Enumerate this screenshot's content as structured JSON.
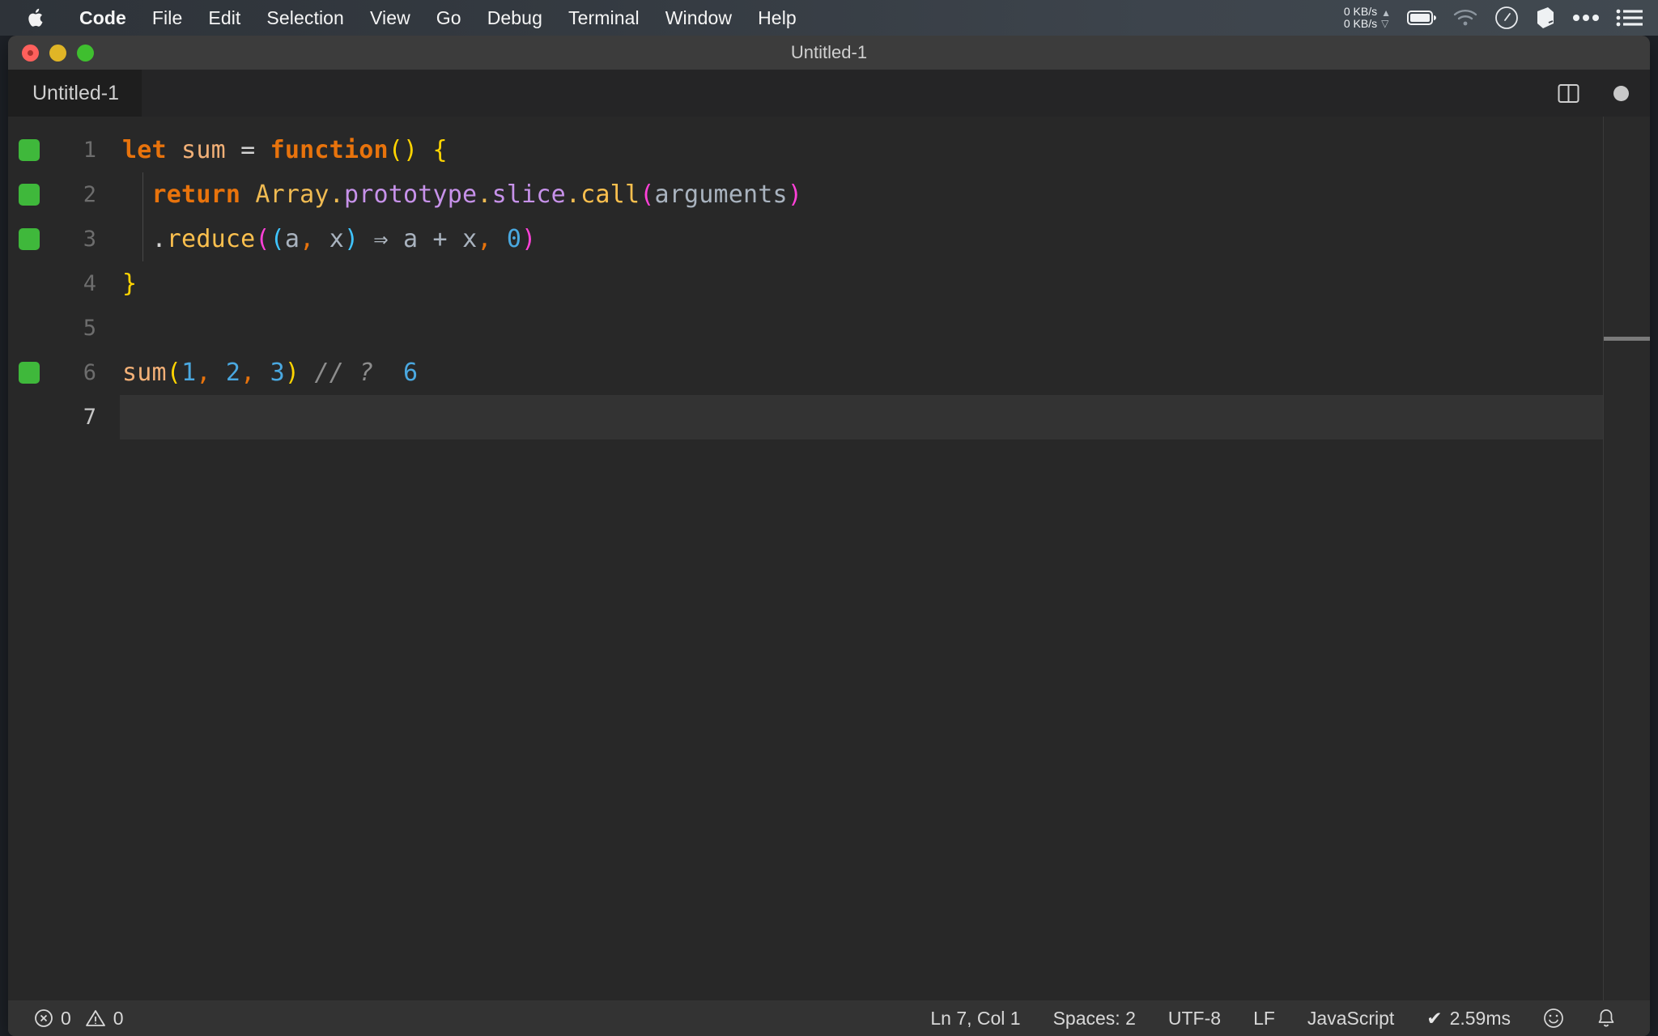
{
  "menubar": {
    "apple_icon": "apple-logo-icon",
    "items": [
      {
        "label": "Code",
        "bold": true
      },
      {
        "label": "File",
        "bold": false
      },
      {
        "label": "Edit",
        "bold": false
      },
      {
        "label": "Selection",
        "bold": false
      },
      {
        "label": "View",
        "bold": false
      },
      {
        "label": "Go",
        "bold": false
      },
      {
        "label": "Debug",
        "bold": false
      },
      {
        "label": "Terminal",
        "bold": false
      },
      {
        "label": "Window",
        "bold": false
      },
      {
        "label": "Help",
        "bold": false
      }
    ],
    "status": {
      "net_up": "0 KB/s",
      "net_down": "0 KB/s",
      "up_arrow": "▲",
      "down_arrow": "▽",
      "icons": [
        "battery-icon",
        "wifi-icon",
        "gauge-icon",
        "cube-icon",
        "ellipsis-icon",
        "list-icon"
      ]
    }
  },
  "window": {
    "title": "Untitled-1",
    "traffic_lights": [
      "close-button",
      "minimize-button",
      "maximize-button"
    ]
  },
  "tabbar": {
    "tabs": [
      {
        "label": "Untitled-1",
        "active": true
      }
    ],
    "actions": [
      "split-editor-icon",
      "unsaved-indicator-dot"
    ]
  },
  "editor": {
    "language": "javascript",
    "active_line": 7,
    "lines": [
      {
        "num": "1",
        "marked": true,
        "indent_guide": false,
        "active": false
      },
      {
        "num": "2",
        "marked": true,
        "indent_guide": true,
        "active": false
      },
      {
        "num": "3",
        "marked": true,
        "indent_guide": true,
        "active": false
      },
      {
        "num": "4",
        "marked": false,
        "indent_guide": false,
        "active": false
      },
      {
        "num": "5",
        "marked": false,
        "indent_guide": false,
        "active": false
      },
      {
        "num": "6",
        "marked": true,
        "indent_guide": false,
        "active": false
      },
      {
        "num": "7",
        "marked": false,
        "indent_guide": false,
        "active": true
      }
    ],
    "code": {
      "l1": {
        "t1": "let",
        "t2": " sum ",
        "t3": "= ",
        "t4": "function",
        "t5": "()",
        "t6": " {"
      },
      "l2": {
        "t1": "  ",
        "t2": "return",
        "t3": " Array",
        "t4": ".",
        "t5": "prototype",
        "t6": ".",
        "t7": "slice",
        "t8": ".",
        "t9": "call",
        "t10": "(",
        "t11": "arguments",
        "t12": ")"
      },
      "l3": {
        "t1": "  .",
        "t2": "reduce",
        "t3": "(",
        "t4": "(",
        "t5": "a",
        "t6": ",",
        "t7": " x",
        "t8": ")",
        "t9": " ⇒ ",
        "t10": "a + x",
        "t11": ",",
        "t12": " 0",
        "t13": ")"
      },
      "l4": {
        "t1": "}"
      },
      "l5": {
        "t1": ""
      },
      "l6": {
        "t1": "sum",
        "t2": "(",
        "t3": "1",
        "t4": ",",
        "t5": " 2",
        "t6": ",",
        "t7": " 3",
        "t8": ")",
        "t9": " // ?  ",
        "t10": "6"
      },
      "l7": {
        "t1": ""
      }
    },
    "colors": {
      "background": "#282828",
      "active_line": "#333333",
      "gutter_marker": "#3fb83b",
      "keyword": "#e8730c",
      "function_name": "#f2b077",
      "paren_yellow": "#ffd400",
      "paren_magenta": "#ff41d8",
      "paren_cyan": "#3fc4ff",
      "class_name": "#f0bb52",
      "property": "#c792ea",
      "method": "#fcc04e",
      "parameter": "#a9b3bf",
      "comma": "#e8730c",
      "number": "#4aa8e0",
      "comment": "#8d8d8d"
    }
  },
  "statusbar": {
    "errors_icon": "error-circle-icon",
    "errors_count": "0",
    "warnings_icon": "warning-triangle-icon",
    "warnings_count": "0",
    "cursor_position": "Ln 7, Col 1",
    "indentation": "Spaces: 2",
    "encoding": "UTF-8",
    "eol": "LF",
    "language_mode": "JavaScript",
    "check_mark": "✔",
    "timing": "2.59ms",
    "feedback_icon": "smiley-icon",
    "notifications_icon": "bell-icon"
  }
}
